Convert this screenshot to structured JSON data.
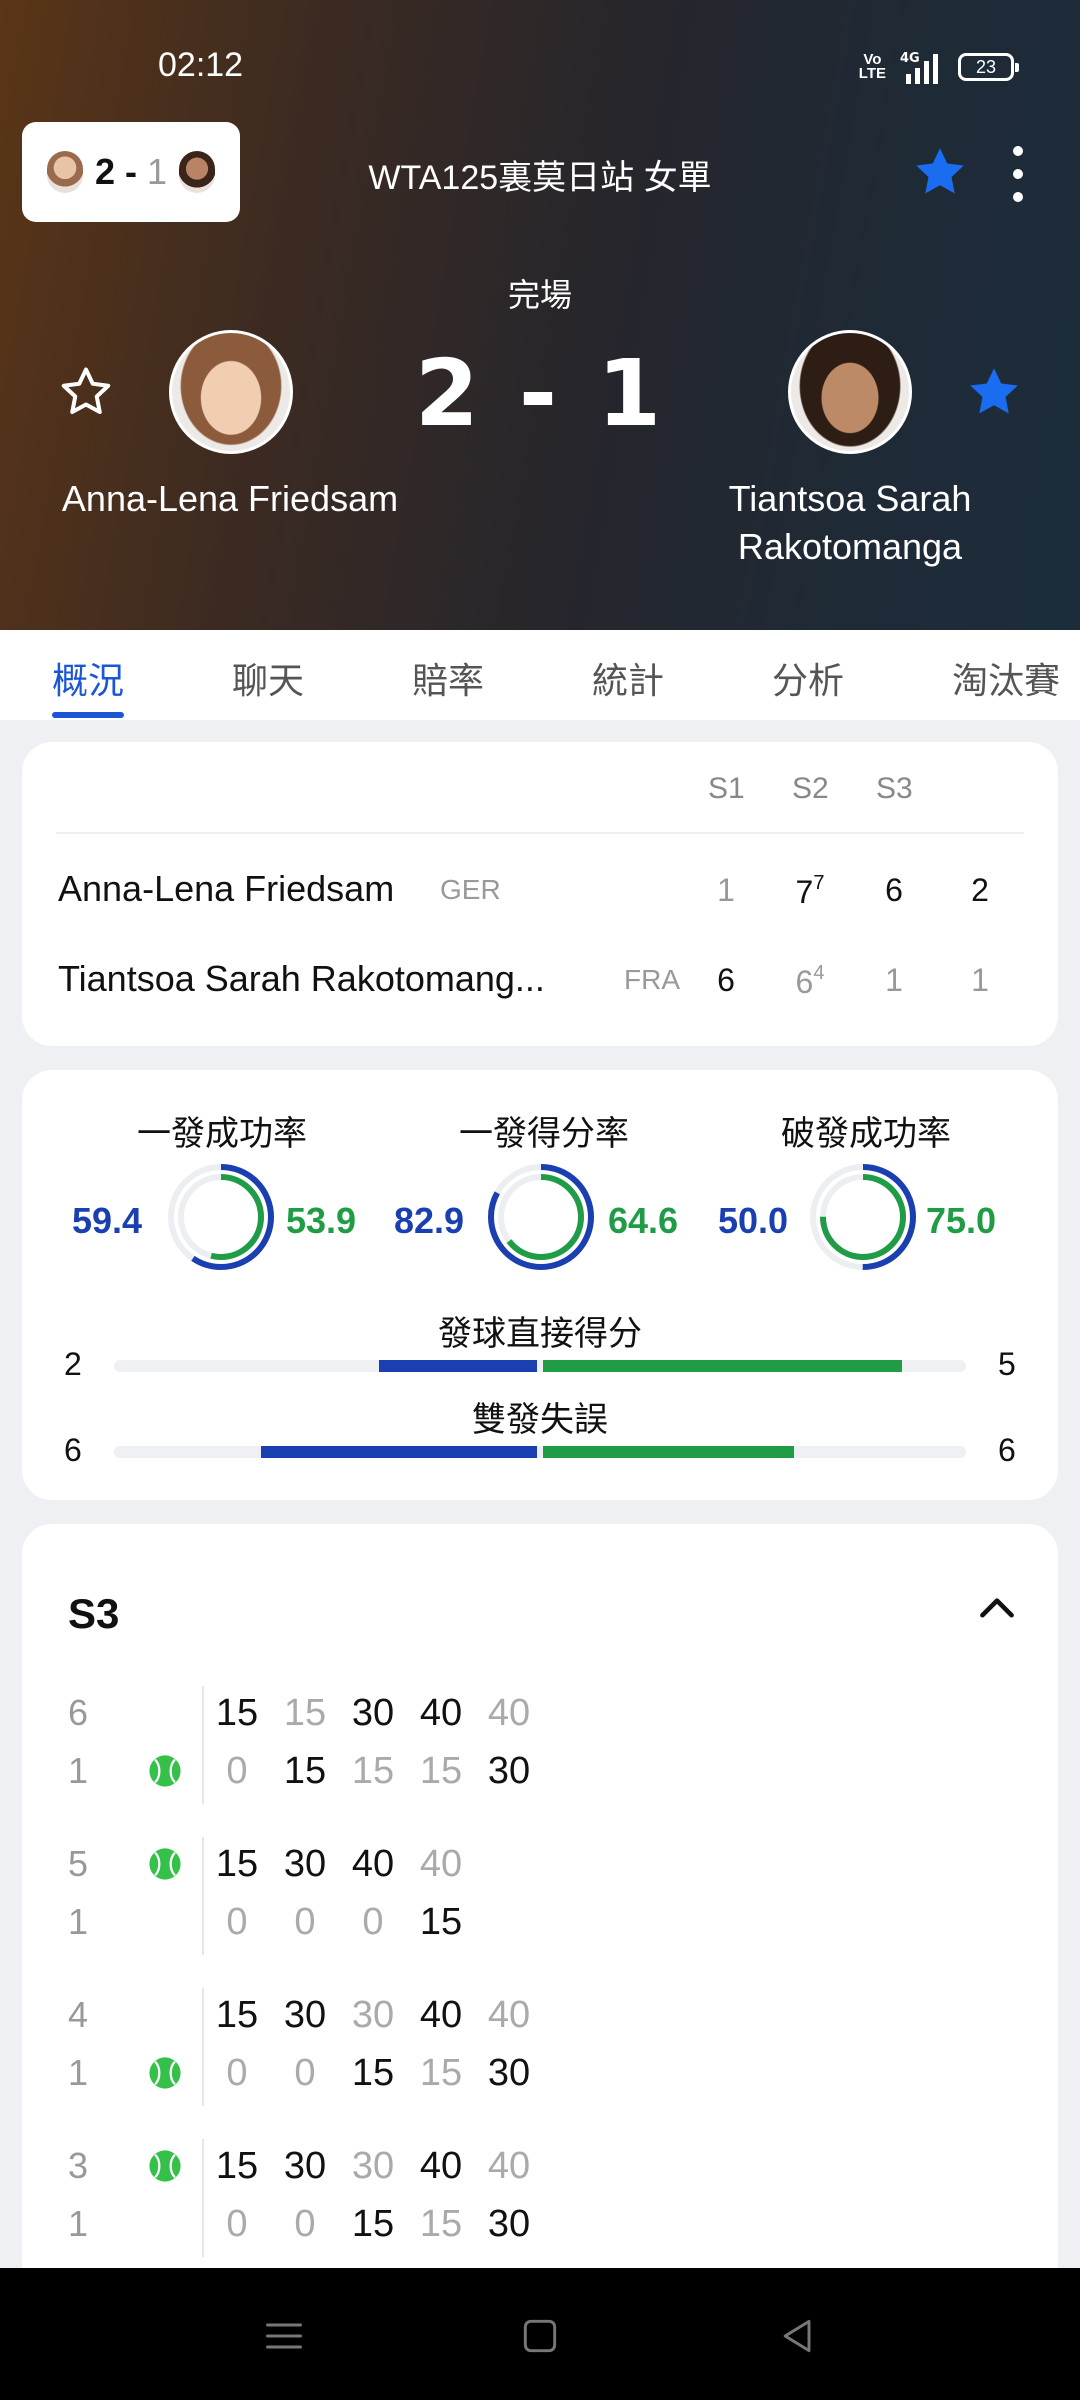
{
  "status_bar": {
    "time": "02:12",
    "volte": "Vo LTE",
    "network": "4G",
    "battery": "23"
  },
  "mini_score": {
    "home": "2",
    "sep": "-",
    "away": "1"
  },
  "header": {
    "tournament": "WTA125裏莫日站 女單",
    "match_status": "完場",
    "score": "2 - 1"
  },
  "players": {
    "home": {
      "name": "Anna-Lena Friedsam",
      "country": "GER",
      "favorite": false
    },
    "away": {
      "name_line1": "Tiantsoa Sarah",
      "name_line2": "Rakotomanga",
      "name_short": "Tiantsoa Sarah Rakotomang...",
      "country": "FRA",
      "favorite": true
    }
  },
  "tabs": [
    "概況",
    "聊天",
    "賠率",
    "統計",
    "分析",
    "淘汰賽"
  ],
  "score_table": {
    "headers": [
      "S1",
      "S2",
      "S3"
    ],
    "home": {
      "sets": [
        "1",
        "7",
        "6"
      ],
      "tiebreak_s2": "7",
      "total": "2"
    },
    "away": {
      "sets": [
        "6",
        "6",
        "1"
      ],
      "tiebreak_s2": "4",
      "total": "1"
    }
  },
  "stats": {
    "rings": [
      {
        "title": "一發成功率",
        "home": "59.4",
        "away": "53.9",
        "home_frac": 0.594,
        "away_frac": 0.539
      },
      {
        "title": "一發得分率",
        "home": "82.9",
        "away": "64.6",
        "home_frac": 0.829,
        "away_frac": 0.646
      },
      {
        "title": "破發成功率",
        "home": "50.0",
        "away": "75.0",
        "home_frac": 0.5,
        "away_frac": 0.75
      }
    ],
    "bars": [
      {
        "title": "發球直接得分",
        "home": "2",
        "away": "5",
        "home_frac": 0.286,
        "away_frac": 0.714
      },
      {
        "title": "雙發失誤",
        "home": "6",
        "away": "6",
        "home_frac": 0.5,
        "away_frac": 0.5
      }
    ]
  },
  "set_detail": {
    "title": "S3",
    "games": [
      {
        "home_games": "6",
        "away_games": "1",
        "server": "away",
        "home_points": [
          "15",
          "15",
          "30",
          "40",
          "40"
        ],
        "away_points": [
          "0",
          "15",
          "15",
          "15",
          "30"
        ],
        "home_dim": [
          false,
          true,
          false,
          false,
          true
        ],
        "away_dim": [
          true,
          false,
          true,
          true,
          false
        ]
      },
      {
        "home_games": "5",
        "away_games": "1",
        "server": "home",
        "home_points": [
          "15",
          "30",
          "40",
          "40"
        ],
        "away_points": [
          "0",
          "0",
          "0",
          "15"
        ],
        "home_dim": [
          false,
          false,
          false,
          true
        ],
        "away_dim": [
          true,
          true,
          true,
          false
        ]
      },
      {
        "home_games": "4",
        "away_games": "1",
        "server": "away",
        "home_points": [
          "15",
          "30",
          "30",
          "40",
          "40"
        ],
        "away_points": [
          "0",
          "0",
          "15",
          "15",
          "30"
        ],
        "home_dim": [
          false,
          false,
          true,
          false,
          true
        ],
        "away_dim": [
          true,
          true,
          false,
          true,
          false
        ]
      },
      {
        "home_games": "3",
        "away_games": "1",
        "server": "home",
        "home_points": [
          "15",
          "30",
          "30",
          "40",
          "40"
        ],
        "away_points": [
          "0",
          "0",
          "15",
          "15",
          "30"
        ],
        "home_dim": [
          false,
          false,
          true,
          false,
          true
        ],
        "away_dim": [
          true,
          true,
          false,
          true,
          false
        ]
      }
    ]
  },
  "colors": {
    "accent": "#1a56d6",
    "home": "#1a3fb0",
    "away": "#1f9c45",
    "star": "#1a6cf0"
  },
  "icons": {
    "fav": "star-icon",
    "menu": "more-vert-icon",
    "collapse": "chevron-up-icon",
    "serve": "tennis-ball-icon"
  }
}
